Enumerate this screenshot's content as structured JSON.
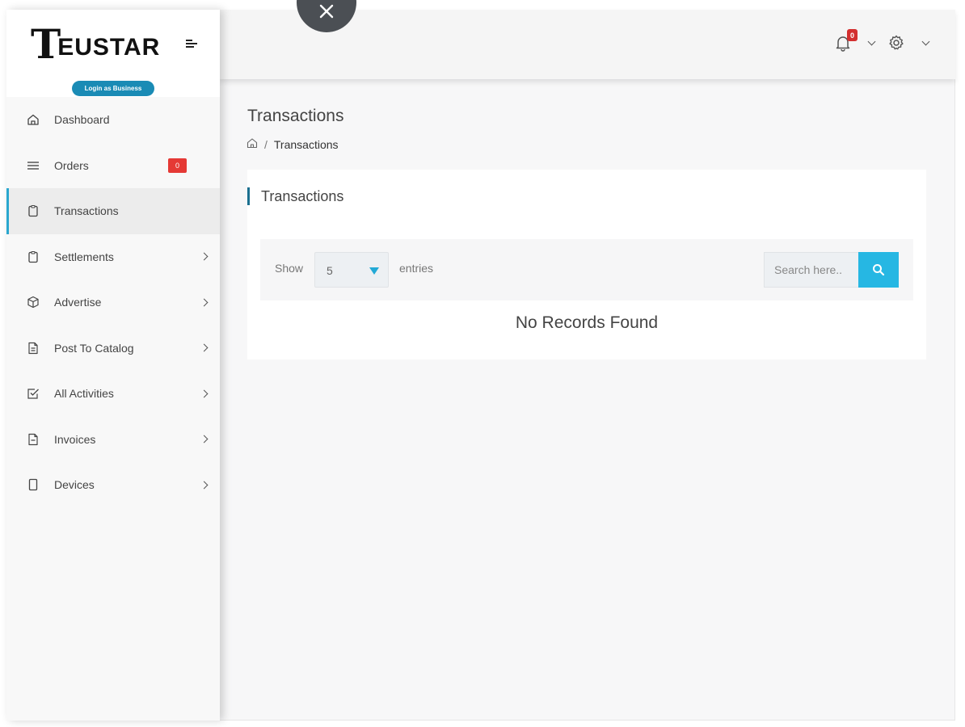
{
  "brand": {
    "logo_first": "T",
    "logo_rest": "EUSTAR",
    "business_button": "Login as Business"
  },
  "sidebar": {
    "items": [
      {
        "label": "Dashboard",
        "icon": "home-icon",
        "chevron": false
      },
      {
        "label": "Orders",
        "icon": "list-icon",
        "chevron": false,
        "badge": "0"
      },
      {
        "label": "Transactions",
        "icon": "clipboard-icon",
        "chevron": false,
        "active": true
      },
      {
        "label": "Settlements",
        "icon": "clipboard-icon",
        "chevron": true
      },
      {
        "label": "Advertise",
        "icon": "box-icon",
        "chevron": true
      },
      {
        "label": "Post To Catalog",
        "icon": "document-icon",
        "chevron": true
      },
      {
        "label": "All Activities",
        "icon": "checkbox-icon",
        "chevron": true
      },
      {
        "label": "Invoices",
        "icon": "document-icon",
        "chevron": true
      },
      {
        "label": "Devices",
        "icon": "device-icon",
        "chevron": true
      }
    ]
  },
  "header": {
    "notification_count": "0"
  },
  "page": {
    "title": "Transactions",
    "breadcrumb": {
      "home_icon": "home-icon",
      "separator": "/",
      "current": "Transactions"
    }
  },
  "card": {
    "title": "Transactions",
    "show_label": "Show",
    "entries_value": "5",
    "entries_label": "entries",
    "search_placeholder": "Search here..",
    "empty_message": "No Records Found"
  },
  "colors": {
    "accent": "#26b7e3",
    "brand_blue": "#1a8bb5",
    "badge_red": "#e53935",
    "active_bar": "#2aa7cf",
    "title_bar": "#1b6f8f"
  }
}
